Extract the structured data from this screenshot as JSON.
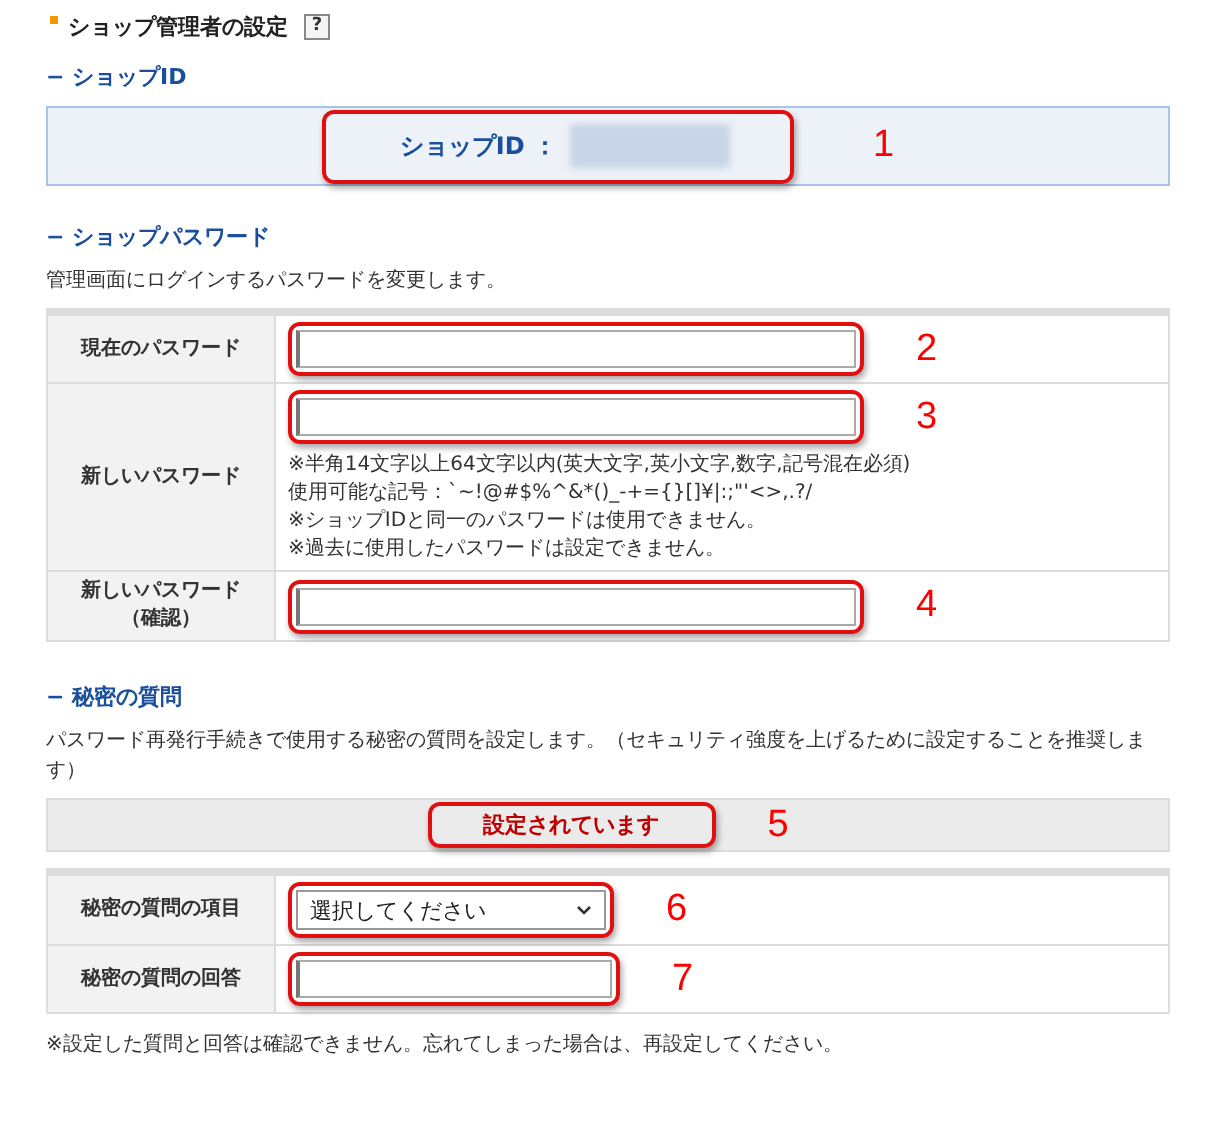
{
  "page_title": "ショップ管理者の設定",
  "help_icon": "?",
  "shop_id": {
    "heading": "− ショップID",
    "label": "ショップID ：",
    "callout": "1"
  },
  "password": {
    "heading": "− ショップパスワード",
    "description": "管理画面にログインするパスワードを変更します。",
    "rows": [
      {
        "label": [
          "現在のパスワード"
        ],
        "kind": "input",
        "callout": "2"
      },
      {
        "label": [
          "新しいパスワード"
        ],
        "kind": "input",
        "callout": "3",
        "notes": [
          "※半角14文字以上64文字以内(英大文字,英小文字,数字,記号混在必須)",
          "使用可能な記号：`~!@#$%^&*()_-+={}[]¥|:;\"'<>,.?/",
          "※ショップIDと同一のパスワードは使用できません。",
          "※過去に使用したパスワードは設定できません。"
        ]
      },
      {
        "label": [
          "新しいパスワード",
          "（確認）"
        ],
        "kind": "input",
        "callout": "4"
      }
    ]
  },
  "secret": {
    "heading": "− 秘密の質問",
    "description": "パスワード再発行手続きで使用する秘密の質問を設定します。（セキュリティ強度を上げるために設定することを推奨します）",
    "status": {
      "text": "設定されています",
      "callout": "5"
    },
    "rows": [
      {
        "label": [
          "秘密の質問の項目"
        ],
        "kind": "select",
        "value": "選択してください",
        "callout": "6"
      },
      {
        "label": [
          "秘密の質問の回答"
        ],
        "kind": "input",
        "callout": "7"
      }
    ],
    "footnote": "※設定した質問と回答は確認できません。忘れてしまった場合は、再設定してください。"
  }
}
